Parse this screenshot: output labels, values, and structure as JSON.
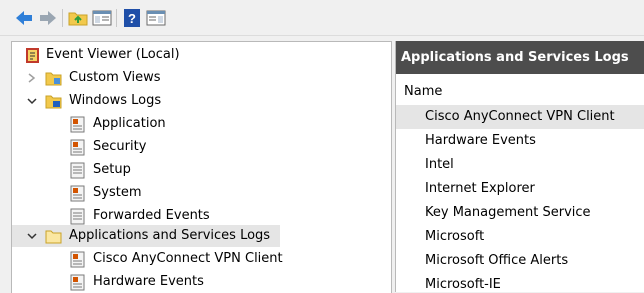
{
  "tree": {
    "root": "Event Viewer (Local)",
    "custom_views": "Custom Views",
    "windows_logs": "Windows Logs",
    "application": "Application",
    "security": "Security",
    "setup": "Setup",
    "system": "System",
    "forwarded_events": "Forwarded Events",
    "apps_services": "Applications and Services Logs",
    "cisco": "Cisco AnyConnect VPN Client",
    "hardware": "Hardware Events"
  },
  "right": {
    "header": "Applications and Services Logs",
    "column_name": "Name",
    "items": [
      "Cisco AnyConnect VPN Client",
      "Hardware Events",
      "Intel",
      "Internet Explorer",
      "Key Management Service",
      "Microsoft",
      "Microsoft Office Alerts",
      "Microsoft-IE"
    ]
  },
  "icons": {
    "toolbar": [
      "back-arrow-icon",
      "forward-arrow-icon",
      "folder-up-icon",
      "show-hide-tree-icon",
      "help-icon",
      "show-hide-action-pane-icon"
    ],
    "colors": {
      "arrow": "#2f7fd8",
      "folder": "#f2c94c",
      "header_bg": "#4d4d4d",
      "selection": "#e5e5e5"
    }
  }
}
